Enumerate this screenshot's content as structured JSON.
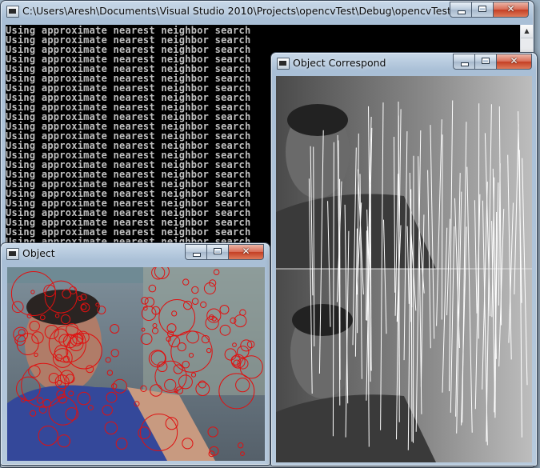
{
  "console": {
    "title": "C:\\Users\\Aresh\\Documents\\Visual Studio 2010\\Projects\\opencvTest\\Debug\\opencvTest.exe",
    "line_text": "Using approximate nearest neighbor search",
    "line_count": 24,
    "scroll_up_glyph": "▲"
  },
  "object_window": {
    "title": "Object"
  },
  "correspond_window": {
    "title": "Object Correspond"
  },
  "controls": {
    "close_glyph": "✕"
  },
  "colors": {
    "console_bg": "#000000",
    "console_text": "#c0c0c0",
    "keypoint": "#e01010",
    "match_line": "#ffffff"
  }
}
